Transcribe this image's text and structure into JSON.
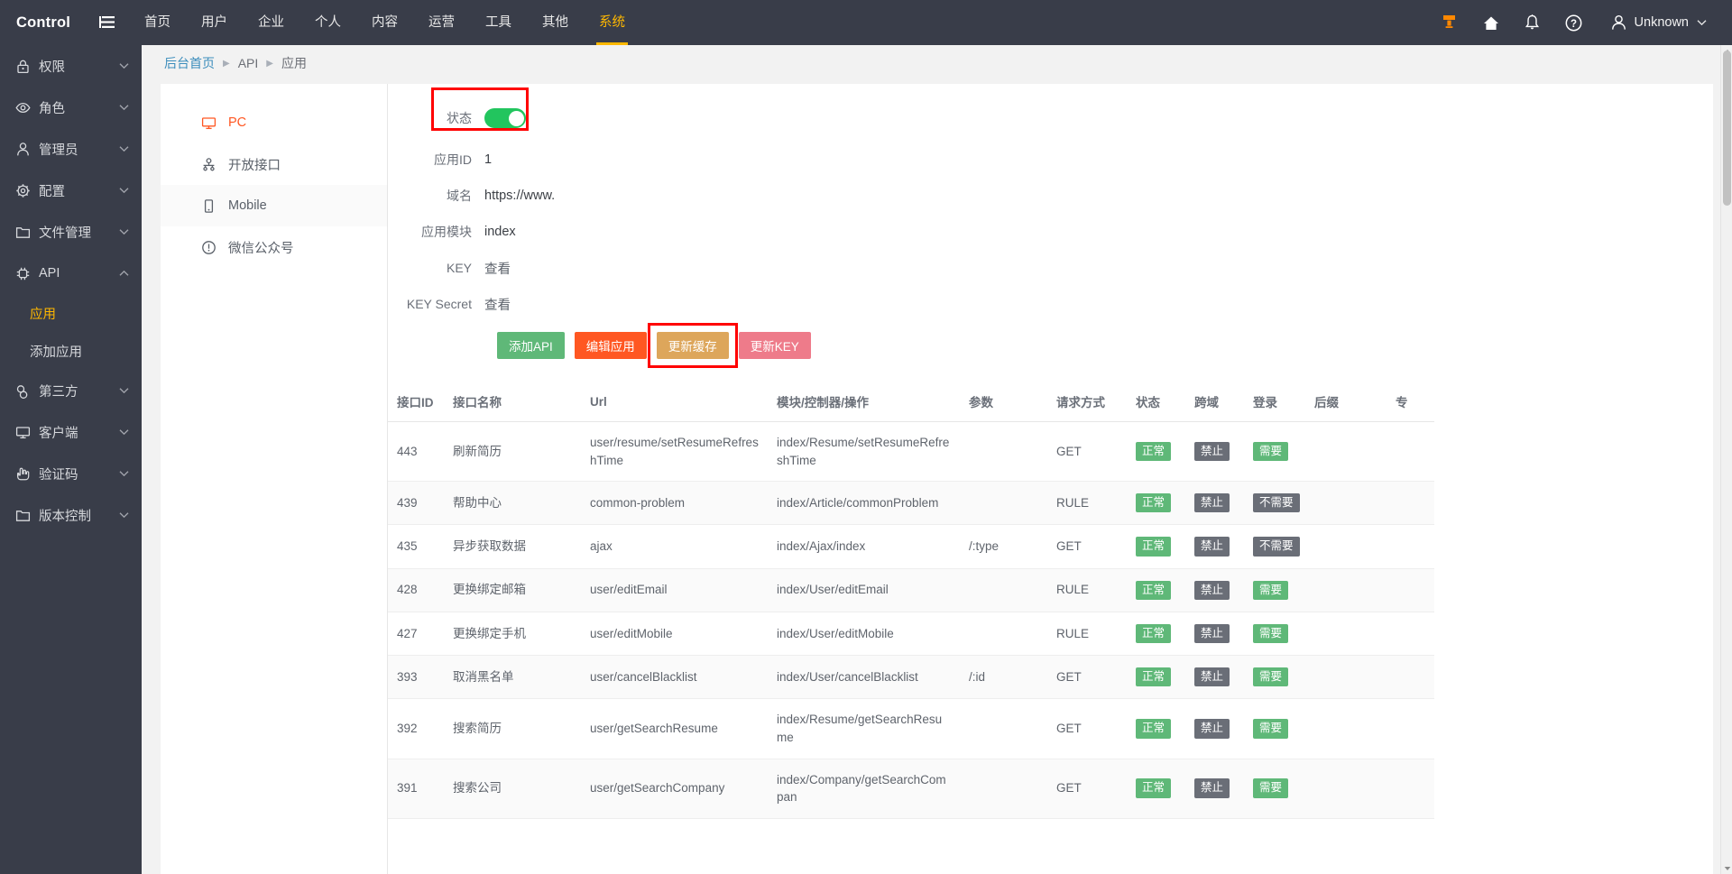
{
  "header": {
    "brand": "Control",
    "menu_icon": "hamburger-icon",
    "nav": [
      {
        "label": "首页",
        "active": false
      },
      {
        "label": "用户",
        "active": false
      },
      {
        "label": "企业",
        "active": false
      },
      {
        "label": "个人",
        "active": false
      },
      {
        "label": "内容",
        "active": false
      },
      {
        "label": "运营",
        "active": false
      },
      {
        "label": "工具",
        "active": false
      },
      {
        "label": "其他",
        "active": false
      },
      {
        "label": "系统",
        "active": true
      }
    ],
    "icons": [
      "brush-icon",
      "home-icon",
      "bell-icon",
      "help-icon"
    ],
    "user": "Unknown",
    "user_caret": "chevron-down-icon"
  },
  "sidebar": {
    "items": [
      {
        "label": "权限",
        "icon": "lock-icon",
        "type": "group",
        "expanded": false
      },
      {
        "label": "角色",
        "icon": "eye-icon",
        "type": "group",
        "expanded": false
      },
      {
        "label": "管理员",
        "icon": "user-icon",
        "type": "group",
        "expanded": false
      },
      {
        "label": "配置",
        "icon": "gear-icon",
        "type": "group",
        "expanded": false
      },
      {
        "label": "文件管理",
        "icon": "folder-icon",
        "type": "group",
        "expanded": false
      },
      {
        "label": "API",
        "icon": "chip-icon",
        "type": "group",
        "expanded": true
      },
      {
        "label": "应用",
        "icon": "",
        "type": "sub",
        "active": true
      },
      {
        "label": "添加应用",
        "icon": "",
        "type": "sub",
        "active": false
      },
      {
        "label": "第三方",
        "icon": "link-icon",
        "type": "group",
        "expanded": false
      },
      {
        "label": "客户端",
        "icon": "monitor-icon",
        "type": "group",
        "expanded": false
      },
      {
        "label": "验证码",
        "icon": "hand-icon",
        "type": "group",
        "expanded": false
      },
      {
        "label": "版本控制",
        "icon": "folder-icon",
        "type": "group",
        "expanded": false
      }
    ]
  },
  "breadcrumb": {
    "home": "后台首页",
    "middle": "API",
    "current": "应用",
    "separator": "▶"
  },
  "left_pane": {
    "items": [
      {
        "label": "PC",
        "icon": "monitor-icon",
        "active": true,
        "hover": false
      },
      {
        "label": "开放接口",
        "icon": "api-node-icon",
        "active": false,
        "hover": false
      },
      {
        "label": "Mobile",
        "icon": "mobile-icon",
        "active": false,
        "hover": true
      },
      {
        "label": "微信公众号",
        "icon": "exclamation-icon",
        "active": false,
        "hover": false
      }
    ]
  },
  "form": {
    "status_label": "状态",
    "status_on": true,
    "fields": [
      {
        "label": "应用ID",
        "value": "1",
        "is_link": false
      },
      {
        "label": "域名",
        "value": "https://www.",
        "is_link": false
      },
      {
        "label": "应用模块",
        "value": "index",
        "is_link": false
      },
      {
        "label": "KEY",
        "value": "查看",
        "is_link": true
      },
      {
        "label": "KEY Secret",
        "value": "查看",
        "is_link": true
      }
    ],
    "buttons": [
      {
        "label": "添加API",
        "color": "#5FB878",
        "highlighted": false
      },
      {
        "label": "编辑应用",
        "color": "#FF5722",
        "highlighted": false
      },
      {
        "label": "更新缓存",
        "color": "#DDA65B",
        "highlighted": true
      },
      {
        "label": "更新KEY",
        "color": "#EE7B8A",
        "highlighted": false
      }
    ]
  },
  "table": {
    "columns": [
      "接口ID",
      "接口名称",
      "Url",
      "模块/控制器/操作",
      "参数",
      "请求方式",
      "状态",
      "跨域",
      "登录",
      "后缀",
      "专"
    ],
    "rows": [
      {
        "id": "443",
        "name": "刷新简历",
        "url": "user/resume/setResumeRefreshTime",
        "mco": "index/Resume/setResumeRefreshTime",
        "params": "",
        "method": "GET",
        "status": "正常",
        "status_color": "green",
        "cors": "禁止",
        "cors_color": "gray",
        "login": "需要",
        "login_color": "green",
        "suffix": "",
        "extra": ""
      },
      {
        "id": "439",
        "name": "帮助中心",
        "url": "common-problem",
        "mco": "index/Article/commonProblem",
        "params": "",
        "method": "RULE",
        "status": "正常",
        "status_color": "green",
        "cors": "禁止",
        "cors_color": "gray",
        "login": "不需要",
        "login_color": "gray",
        "suffix": "",
        "extra": ""
      },
      {
        "id": "435",
        "name": "异步获取数据",
        "url": "ajax",
        "mco": "index/Ajax/index",
        "params": "/:type",
        "method": "GET",
        "status": "正常",
        "status_color": "green",
        "cors": "禁止",
        "cors_color": "gray",
        "login": "不需要",
        "login_color": "gray",
        "suffix": "",
        "extra": ""
      },
      {
        "id": "428",
        "name": "更换绑定邮箱",
        "url": "user/editEmail",
        "mco": "index/User/editEmail",
        "params": "",
        "method": "RULE",
        "status": "正常",
        "status_color": "green",
        "cors": "禁止",
        "cors_color": "gray",
        "login": "需要",
        "login_color": "green",
        "suffix": "",
        "extra": ""
      },
      {
        "id": "427",
        "name": "更换绑定手机",
        "url": "user/editMobile",
        "mco": "index/User/editMobile",
        "params": "",
        "method": "RULE",
        "status": "正常",
        "status_color": "green",
        "cors": "禁止",
        "cors_color": "gray",
        "login": "需要",
        "login_color": "green",
        "suffix": "",
        "extra": ""
      },
      {
        "id": "393",
        "name": "取消黑名单",
        "url": "user/cancelBlacklist",
        "mco": "index/User/cancelBlacklist",
        "params": "/:id",
        "method": "GET",
        "status": "正常",
        "status_color": "green",
        "cors": "禁止",
        "cors_color": "gray",
        "login": "需要",
        "login_color": "green",
        "suffix": "",
        "extra": ""
      },
      {
        "id": "392",
        "name": "搜索简历",
        "url": "user/getSearchResume",
        "mco": "index/Resume/getSearchResume",
        "params": "",
        "method": "GET",
        "status": "正常",
        "status_color": "green",
        "cors": "禁止",
        "cors_color": "gray",
        "login": "需要",
        "login_color": "green",
        "suffix": "",
        "extra": ""
      },
      {
        "id": "391",
        "name": "搜索公司",
        "url": "user/getSearchCompany",
        "mco": "index/Company/getSearchCompan",
        "params": "",
        "method": "GET",
        "status": "正常",
        "status_color": "green",
        "cors": "禁止",
        "cors_color": "gray",
        "login": "需要",
        "login_color": "green",
        "suffix": "",
        "extra": ""
      }
    ]
  },
  "colors": {
    "topbar_bg": "#393D49",
    "accent_orange": "#FF5722",
    "accent_yellow": "#FFB800",
    "green": "#5FB878",
    "gray_badge": "#6a6e77",
    "link_blue": "#3c8dbc",
    "highlight_red": "#FF0000"
  }
}
